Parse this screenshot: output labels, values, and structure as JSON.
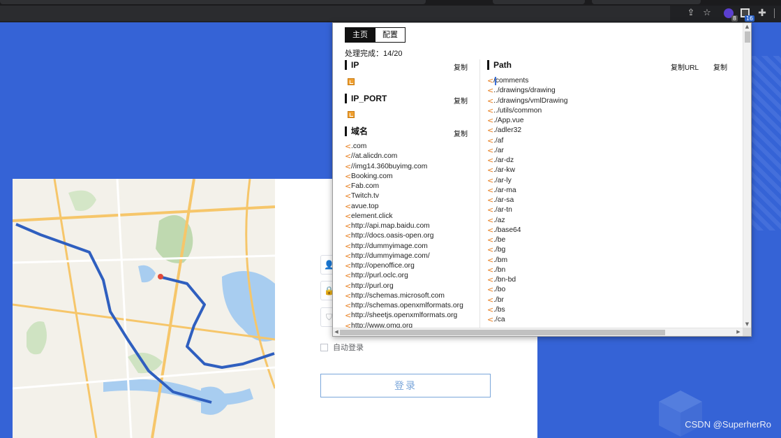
{
  "browser": {
    "toolbar_icons": [
      "share-icon",
      "star-icon",
      "extension-purple-icon",
      "extension-findsomething-icon",
      "puzzle-icon"
    ],
    "badges": {
      "extension_purple": "8",
      "extension_findsomething": "16"
    }
  },
  "popup": {
    "tabs": [
      {
        "label": "主页",
        "active": true
      },
      {
        "label": "配置",
        "active": false
      }
    ],
    "progress_text": "处理完成：14/20",
    "ip": {
      "title": "IP",
      "copy_label": "复制"
    },
    "ip_port": {
      "title": "IP_PORT",
      "copy_label": "复制"
    },
    "domain": {
      "title": "域名",
      "copy_label": "复制",
      "items": [
        ".com",
        "//at.alicdn.com",
        "//img14.360buyimg.com",
        "Booking.com",
        "Fab.com",
        "Twitch.tv",
        "avue.top",
        "element.click",
        "http://api.map.baidu.com",
        "http://docs.oasis-open.org",
        "http://dummyimage.com",
        "http://dummyimage.com/",
        "http://openoffice.org",
        "http://purl.oclc.org",
        "http://purl.org",
        "http://schemas.microsoft.com",
        "http://schemas.openxmlformats.org",
        "http://sheetjs.openxmlformats.org",
        "http://www.omg.org"
      ]
    },
    "path": {
      "title": "Path",
      "copy_url_label": "复制URL",
      "copy_label": "复制",
      "items": [
        "/comments",
        "../drawings/drawing",
        "../drawings/vmlDrawing",
        "../utils/common",
        "./App.vue",
        "./adler32",
        "./af",
        "./ar",
        "./ar-dz",
        "./ar-kw",
        "./ar-ly",
        "./ar-ma",
        "./ar-sa",
        "./ar-tn",
        "./az",
        "./base64",
        "./be",
        "./bg",
        "./bm",
        "./bn",
        "./bn-bd",
        "./bo",
        "./br",
        "./bs",
        "./ca"
      ]
    }
  },
  "login": {
    "remember_label": "自动登录",
    "submit_label": "登录",
    "icons": [
      "user-icon",
      "lock-icon",
      "shield-icon"
    ]
  },
  "colors": {
    "page_background": "#3563d6",
    "accent_orange": "#e87e1e",
    "route_blue": "#2f5fbf",
    "button_border": "#7aa6da"
  },
  "watermark": "CSDN @SuperherRo"
}
